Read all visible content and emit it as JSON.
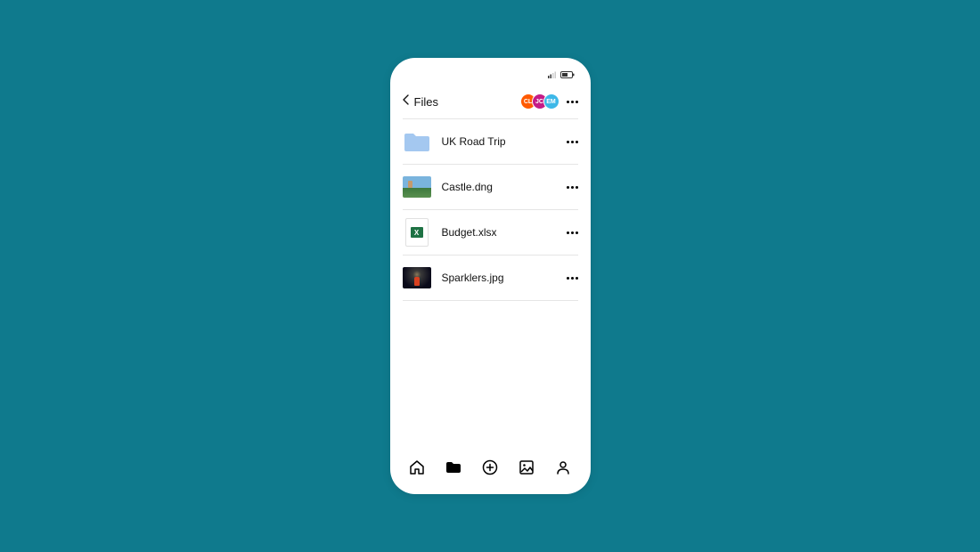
{
  "header": {
    "back_label": "Files"
  },
  "avatars": [
    {
      "initials": "CL",
      "color": "#ff5a00"
    },
    {
      "initials": "JC",
      "color": "#c41c87"
    },
    {
      "initials": "EM",
      "color": "#3db8e8"
    }
  ],
  "files": [
    {
      "name": "UK Road Trip",
      "type": "folder"
    },
    {
      "name": "Castle.dng",
      "type": "image-castle"
    },
    {
      "name": "Budget.xlsx",
      "type": "xlsx"
    },
    {
      "name": "Sparklers.jpg",
      "type": "image-sparklers"
    }
  ],
  "nav": {
    "home": "home",
    "files": "files",
    "add": "add",
    "photos": "photos",
    "account": "account"
  }
}
